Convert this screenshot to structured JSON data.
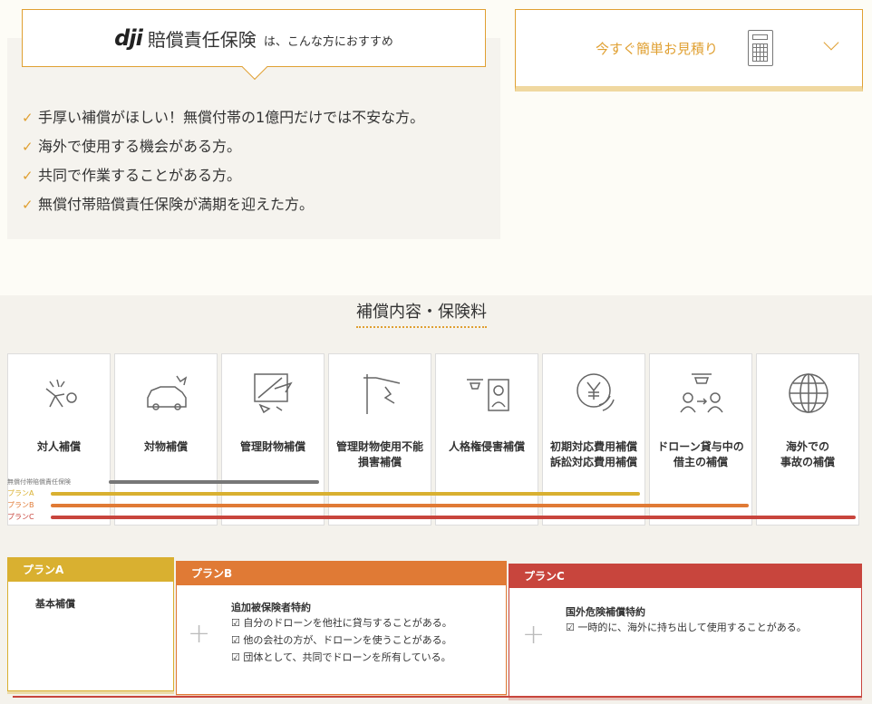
{
  "recommend": {
    "logo": "dji",
    "title": "賠償責任保険",
    "subtitle": "は、こんな方におすすめ",
    "items": [
      "手厚い補償がほしい！無償付帯の1億円だけでは不安な方。",
      "海外で使用する機会がある方。",
      "共同で作業することがある方。",
      "無償付帯賠償責任保険が満期を迎えた方。"
    ]
  },
  "estimate": {
    "label": "今すぐ簡単お見積り",
    "icon": "calculator-icon",
    "chevron": "chevron-down-icon"
  },
  "coverage": {
    "title": "補償内容・保険料",
    "cards": [
      {
        "icon": "person-injury-icon",
        "label": "対人補償"
      },
      {
        "icon": "car-damage-icon",
        "label": "対物補償"
      },
      {
        "icon": "window-break-icon",
        "label": "管理財物補償"
      },
      {
        "icon": "pole-damage-icon",
        "label": "管理財物使用不能\n損害補償"
      },
      {
        "icon": "drone-privacy-icon",
        "label": "人格権侵害補償"
      },
      {
        "icon": "yen-coin-icon",
        "label": "初期対応費用補償\n訴訟対応費用補償"
      },
      {
        "icon": "drone-lending-icon",
        "label": "ドローン貸与中の\n借主の補償"
      },
      {
        "icon": "globe-icon",
        "label": "海外での\n事故の補償"
      }
    ],
    "bars": [
      {
        "label": "無償付帯賠償責任保険",
        "color": "#777777",
        "span": 3
      },
      {
        "label": "プランA",
        "color": "#d9b030",
        "span": 6
      },
      {
        "label": "プランB",
        "color": "#e07a35",
        "span": 7
      },
      {
        "label": "プランC",
        "color": "#c8453d",
        "span": 8
      }
    ]
  },
  "plans": {
    "a": {
      "name": "プランA",
      "color": "#d9b030",
      "title": "基本補償"
    },
    "b": {
      "name": "プランB",
      "color": "#e07a35",
      "title": "追加被保険者特約",
      "items": [
        "☑ 自分のドローンを他社に貸与することがある。",
        "☑ 他の会社の方が、ドローンを使うことがある。",
        "☑ 団体として、共同でドローンを所有している。"
      ]
    },
    "c": {
      "name": "プランC",
      "color": "#c8453d",
      "title": "国外危険補償特約",
      "items": [
        "☑ 一時的に、海外に持ち出して使用することがある。"
      ]
    },
    "plus": "+"
  }
}
